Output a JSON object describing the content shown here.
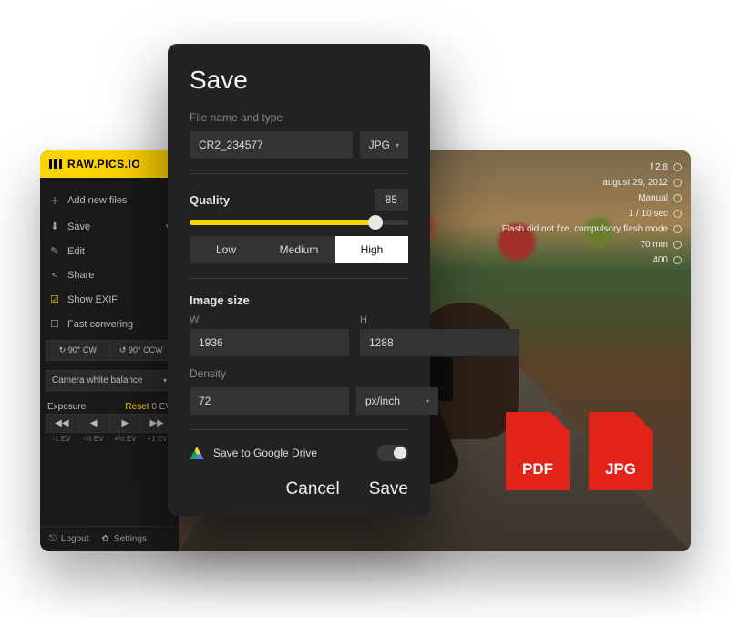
{
  "logo": {
    "text": "RAW.PICS.IO"
  },
  "sidebar": {
    "add": "Add new files",
    "save": "Save",
    "edit": "Edit",
    "share": "Share",
    "show_exif": "Show EXIF",
    "fast_conv": "Fast convering",
    "rotate_cw": "↻ 90° CW",
    "rotate_ccw": "↺ 90° CCW",
    "wb": "Camera white balance",
    "exposure_label": "Exposure",
    "reset": "Reset",
    "reset_ev": "0 EV",
    "ev_buttons": [
      "◀◀",
      "◀",
      "▶",
      "▶▶"
    ],
    "ev_labels": [
      "-1 EV",
      "-½ EV",
      "+½ EV",
      "+1 EV"
    ],
    "logout": "Logout",
    "settings": "Settings"
  },
  "exif": {
    "aperture": "f 2.8",
    "date": "august 29, 2012",
    "mode": "Manual",
    "shutter": "1 / 10 sec",
    "flash": "Flash did not fire, compulsory flash mode",
    "focal": "70 mm",
    "iso": "400"
  },
  "dialog": {
    "title": "Save",
    "filename_label": "File name and type",
    "filename": "CR2_234577",
    "filetype": "JPG",
    "quality_label": "Quality",
    "quality_value": "85",
    "quality_low": "Low",
    "quality_med": "Medium",
    "quality_high": "High",
    "image_size_label": "Image size",
    "w_label": "W",
    "h_label": "H",
    "w": "1936",
    "h": "1288",
    "density_label": "Density",
    "density": "72",
    "density_unit": "px/inch",
    "gdrive": "Save to Google Drive",
    "cancel": "Cancel",
    "save": "Save"
  },
  "badges": {
    "pdf": "PDF",
    "jpg": "JPG"
  }
}
